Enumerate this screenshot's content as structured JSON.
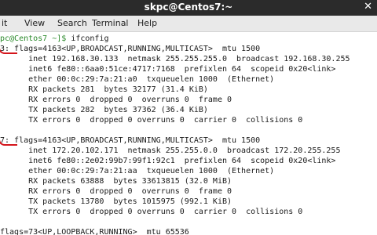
{
  "window": {
    "title": "skpc@Centos7:~",
    "close_glyph": "✕"
  },
  "menu": {
    "view": "View",
    "search": "Search",
    "terminal": "Terminal",
    "help": "Help",
    "partial_edit": "it"
  },
  "terminal": {
    "prompt": "pc@Centos7 ~]$",
    "command": " ifconfig",
    "lines": [
      "3: flags=4163<UP,BROADCAST,RUNNING,MULTICAST>  mtu 1500",
      "      inet 192.168.30.133  netmask 255.255.255.0  broadcast 192.168.30.255",
      "      inet6 fe80::6aa0:51ce:4717:7168  prefixlen 64  scopeid 0x20<link>",
      "      ether 00:0c:29:7a:21:a0  txqueuelen 1000  (Ethernet)",
      "      RX packets 281  bytes 32177 (31.4 KiB)",
      "      RX errors 0  dropped 0  overruns 0  frame 0",
      "      TX packets 282  bytes 37362 (36.4 KiB)",
      "      TX errors 0  dropped 0 overruns 0  carrier 0  collisions 0",
      "",
      "7: flags=4163<UP,BROADCAST,RUNNING,MULTICAST>  mtu 1500",
      "      inet 172.20.102.171  netmask 255.255.0.0  broadcast 172.20.255.255",
      "      inet6 fe80::2e02:99b7:99f1:92c1  prefixlen 64  scopeid 0x20<link>",
      "      ether 00:0c:29:7a:21:aa  txqueuelen 1000  (Ethernet)",
      "      RX packets 63888  bytes 33613815 (32.0 MiB)",
      "      RX errors 0  dropped 0  overruns 0  frame 0",
      "      TX packets 13780  bytes 1015975 (992.1 KiB)",
      "      TX errors 0  dropped 0 overruns 0  carrier 0  collisions 0",
      "",
      "flags=73<UP,LOOPBACK,RUNNING>  mtu 65536"
    ]
  },
  "colors": {
    "titlebar": "#2b2b2b",
    "prompt": "#2b8a2b",
    "annotation": "#d4141b"
  }
}
